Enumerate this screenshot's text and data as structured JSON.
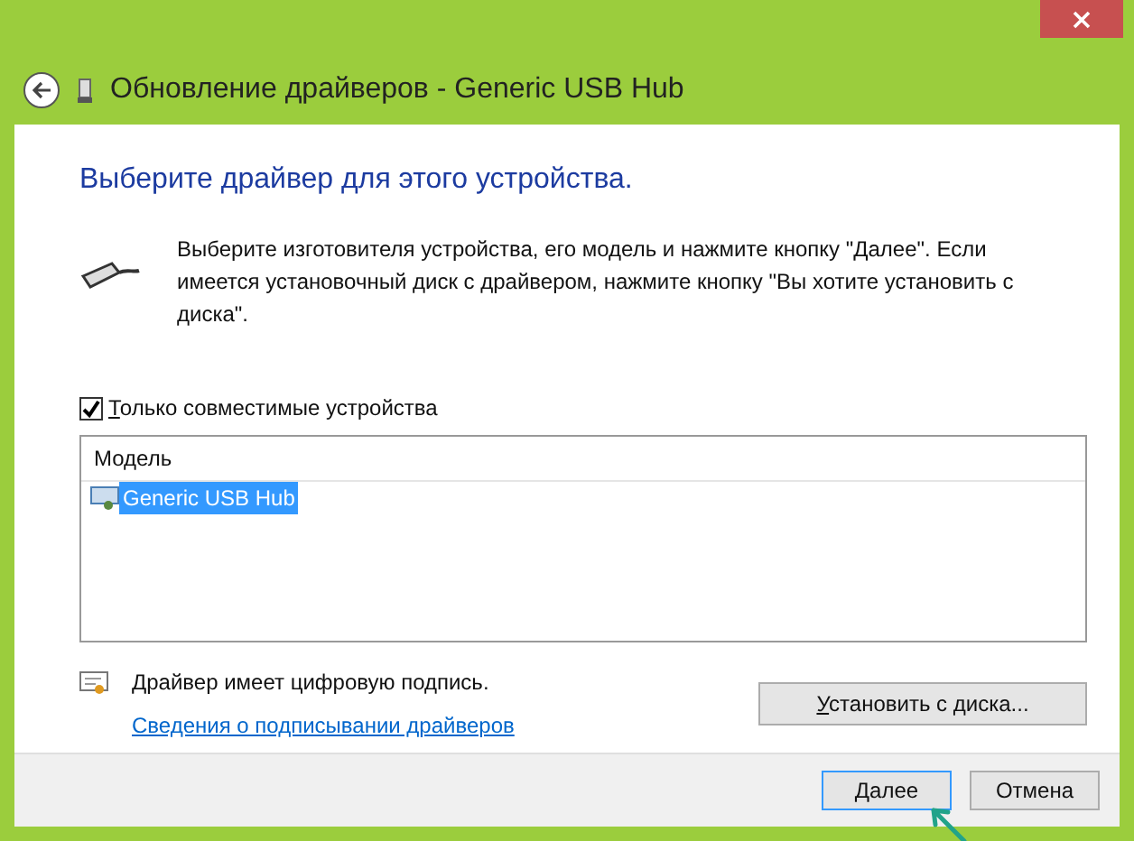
{
  "window": {
    "title": "Обновление драйверов - Generic USB Hub"
  },
  "heading": "Выберите драйвер для этого устройства.",
  "instructions": "Выберите изготовителя устройства, его модель и нажмите кнопку \"Далее\". Если имеется установочный диск с  драйвером, нажмите кнопку \"Вы хотите установить с диска\".",
  "compatible_only": {
    "label": "Только совместимые устройства",
    "checked": true
  },
  "model_list": {
    "column": "Модель",
    "items": [
      {
        "label": "Generic USB Hub",
        "selected": true
      }
    ]
  },
  "signature": {
    "text": "Драйвер имеет цифровую подпись.",
    "link": "Сведения о подписывании драйверов"
  },
  "have_disk_button": "Установить с диска...",
  "buttons": [
    {
      "label": "Далее",
      "default": true
    },
    {
      "label": "Отмена",
      "default": false
    }
  ]
}
